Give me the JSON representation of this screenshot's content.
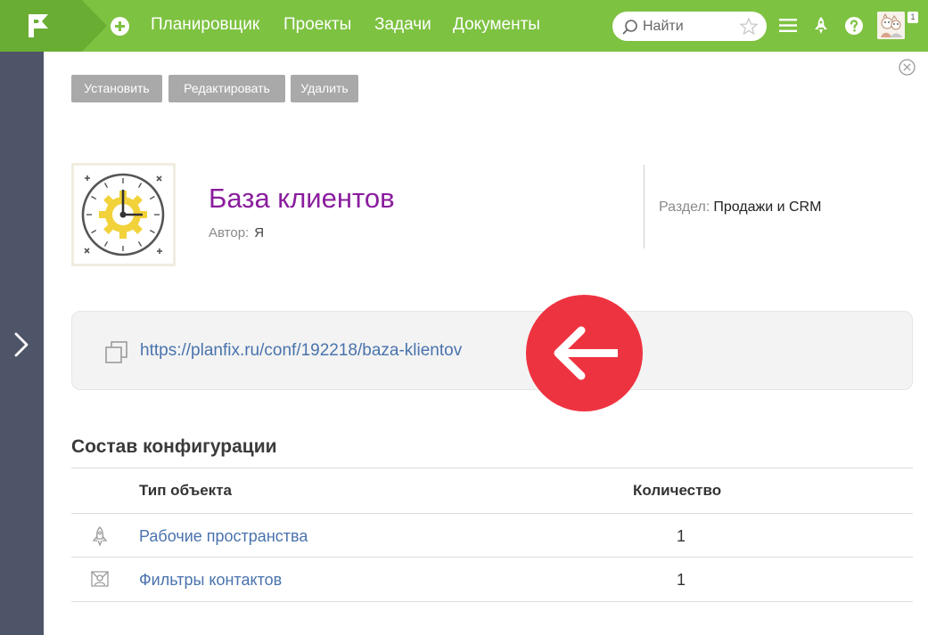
{
  "nav": {
    "items": [
      "Планировщик",
      "Проекты",
      "Задачи",
      "Документы"
    ],
    "search_placeholder": "Найти",
    "avatar_badge": "1"
  },
  "toolbar": {
    "install_label": "Установить",
    "edit_label": "Редактировать",
    "delete_label": "Удалить"
  },
  "config": {
    "title": "База клиентов",
    "author_label": "Автор:",
    "author_value": "Я",
    "section_label": "Раздел:",
    "section_value": "Продажи и CRM",
    "url": "https://planfix.ru/conf/192218/baza-klientov"
  },
  "composition": {
    "title": "Состав конфигурации",
    "columns": [
      "Тип объекта",
      "Количество"
    ],
    "rows": [
      {
        "icon": "rocket-icon",
        "name": "Рабочие пространства",
        "count": "1"
      },
      {
        "icon": "contact-filter-icon",
        "name": "Фильтры контактов",
        "count": "1"
      }
    ]
  },
  "colors": {
    "topbar": "#7dc241",
    "sidebar": "#4f5568",
    "title": "#8a1d9e",
    "link": "#4a73ad",
    "accent_red": "#ee3340"
  }
}
